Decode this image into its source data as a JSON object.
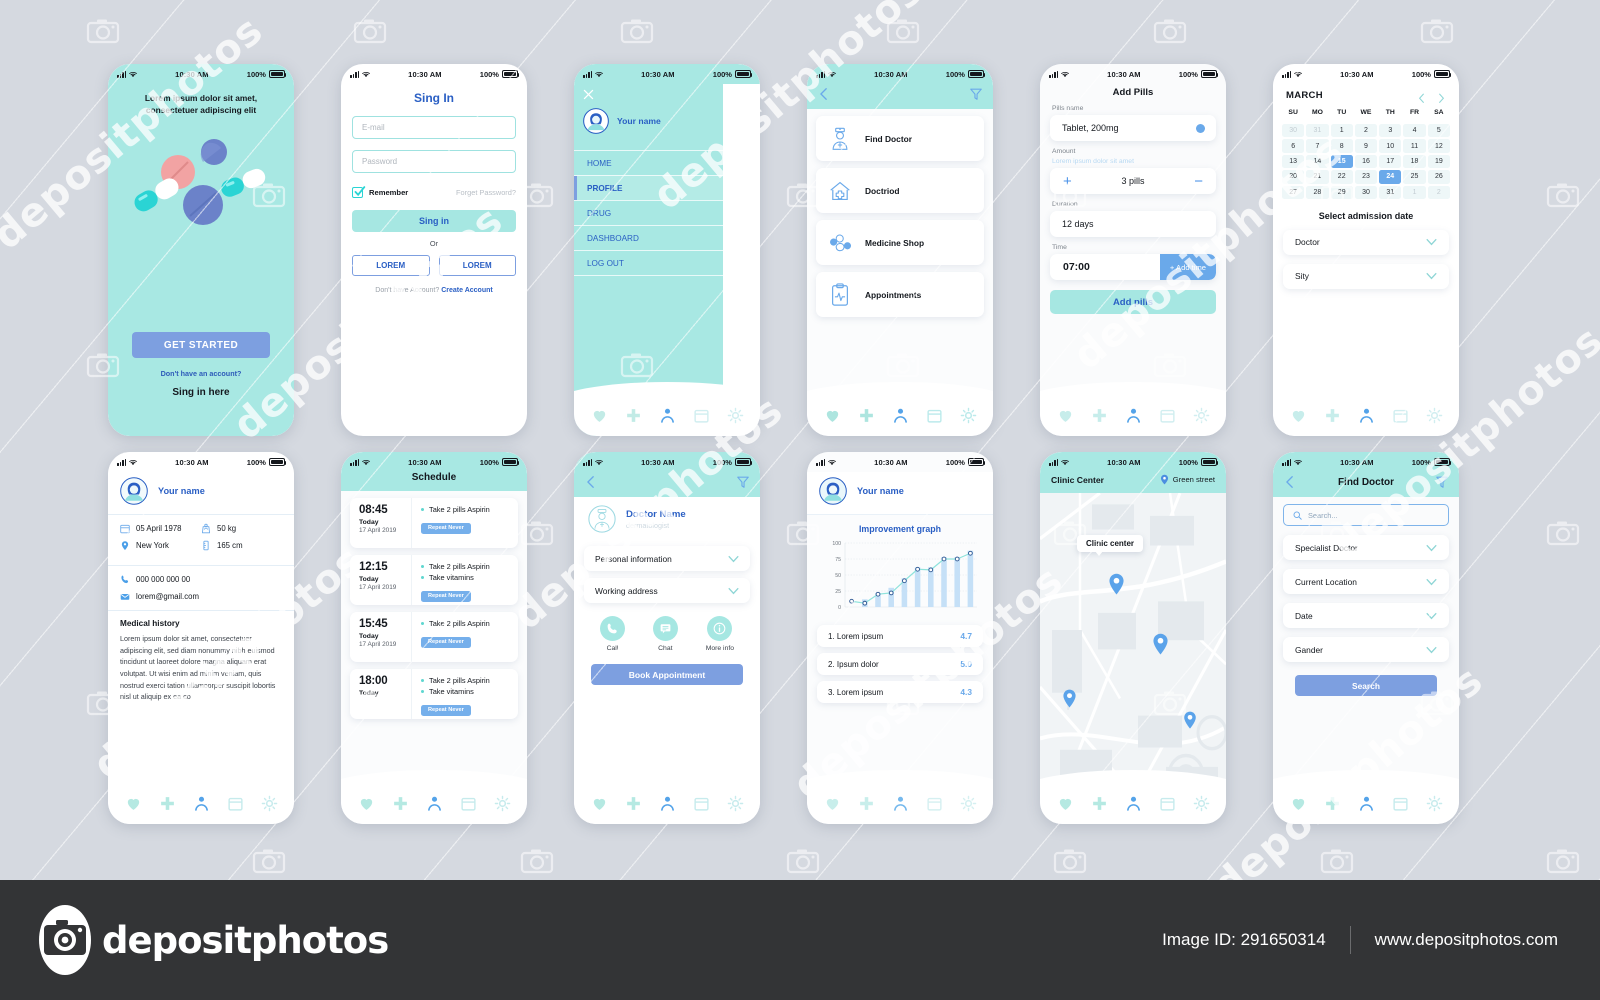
{
  "status_bar": {
    "time": "10:30 AM",
    "battery": "100%"
  },
  "bottom_nav": [
    {
      "icon": "heart-icon"
    },
    {
      "icon": "plus-icon"
    },
    {
      "icon": "person-icon"
    },
    {
      "icon": "calendar-icon"
    },
    {
      "icon": "gear-icon"
    }
  ],
  "screens": {
    "onboarding": {
      "headline": "Lorem ipsum dolor sit amet, consectetuer adipiscing elit",
      "cta": "GET STARTED",
      "no_account": "Don't have an account?",
      "sign_in_here": "Sing in here"
    },
    "signin": {
      "title": "Sing In",
      "email_placeholder": "E-mail",
      "password_placeholder": "Password",
      "remember": "Remember",
      "forget": "Forget Password?",
      "submit": "Sing in",
      "or": "Or",
      "social_left": "LOREM",
      "social_right": "LOREM",
      "footer_prefix": "Don't have Account?",
      "footer_link": "Create Account"
    },
    "drawer": {
      "user_name": "Your name",
      "items": [
        {
          "label": "HOME",
          "active": false
        },
        {
          "label": "PROFILE",
          "active": true
        },
        {
          "label": "DRUG",
          "active": false
        },
        {
          "label": "DASHBOARD",
          "active": false
        },
        {
          "label": "LOG OUT",
          "active": false
        }
      ]
    },
    "services": {
      "items": [
        {
          "label": "Find Doctor",
          "icon": "doctor-icon"
        },
        {
          "label": "Doctriod",
          "icon": "hospital-icon"
        },
        {
          "label": "Medicine Shop",
          "icon": "capsule-icon"
        },
        {
          "label": "Appointments",
          "icon": "clipboard-pulse-icon"
        }
      ]
    },
    "add_pills": {
      "title": "Add Pills",
      "name_label": "Pills name",
      "name_value": "Tablet, 200mg",
      "amount_label": "Amount",
      "amount_hint": "Lorem ipsum dolor sit amet",
      "amount_value": "3 pills",
      "plus": "+",
      "minus": "−",
      "duration_label": "Duration",
      "duration_value": "12 days",
      "time_label": "Time",
      "time_value": "07:00",
      "add_time": "+ Add time",
      "submit": "Add pills"
    },
    "calendar": {
      "month": "MARCH",
      "weekdays": [
        "SU",
        "MO",
        "TU",
        "WE",
        "TH",
        "FR",
        "SA"
      ],
      "days": [
        {
          "n": "30",
          "mute": true
        },
        {
          "n": "31",
          "mute": true
        },
        {
          "n": "1"
        },
        {
          "n": "2"
        },
        {
          "n": "3"
        },
        {
          "n": "4"
        },
        {
          "n": "5"
        },
        {
          "n": "6"
        },
        {
          "n": "7"
        },
        {
          "n": "8"
        },
        {
          "n": "9"
        },
        {
          "n": "10"
        },
        {
          "n": "11"
        },
        {
          "n": "12"
        },
        {
          "n": "13"
        },
        {
          "n": "14"
        },
        {
          "n": "15",
          "selected": true
        },
        {
          "n": "16"
        },
        {
          "n": "17"
        },
        {
          "n": "18"
        },
        {
          "n": "19"
        },
        {
          "n": "20"
        },
        {
          "n": "21"
        },
        {
          "n": "22"
        },
        {
          "n": "23"
        },
        {
          "n": "24",
          "selected": true
        },
        {
          "n": "25"
        },
        {
          "n": "26"
        },
        {
          "n": "27"
        },
        {
          "n": "28"
        },
        {
          "n": "29"
        },
        {
          "n": "30"
        },
        {
          "n": "31"
        },
        {
          "n": "1",
          "mute": true
        },
        {
          "n": "2",
          "mute": true
        }
      ],
      "select_title": "Select admission date",
      "dropdowns": [
        "Doctor",
        "Sity"
      ]
    },
    "profile": {
      "user_name": "Your name",
      "birth_date": "05 April 1978",
      "city": "New York",
      "weight": "50 kg",
      "height": "165 cm",
      "phone": "000 000 000 00",
      "email": "lorem@gmail.com",
      "history_title": "Medical history",
      "history_text": "Lorem ipsum dolor sit amet, consectetuer adipiscing elit, sed diam nonummy nibh euismod tincidunt ut laoreet dolore magna aliquam erat volutpat. Ut wisi enim ad minim veniam, quis nostrud exerci tation ullamcorper suscipit lobortis nisl ut aliquip ex ea co"
    },
    "schedule": {
      "title": "Schedule",
      "items": [
        {
          "time": "08:45",
          "day": "Today",
          "date": "17 April 2019",
          "tasks": [
            "Take 2 pills Aspirin"
          ],
          "repeat": "Repeat Never"
        },
        {
          "time": "12:15",
          "day": "Today",
          "date": "17 April 2019",
          "tasks": [
            "Take 2 pills Aspirin",
            "Take vitamins"
          ],
          "repeat": "Repeat Never"
        },
        {
          "time": "15:45",
          "day": "Today",
          "date": "17 April 2019",
          "tasks": [
            "Take 2 pills Aspirin"
          ],
          "repeat": "Repeat Never"
        },
        {
          "time": "18:00",
          "day": "Today",
          "date": "",
          "tasks": [
            "Take 2 pills Aspirin",
            "Take vitamins"
          ],
          "repeat": "Repeat Never"
        }
      ]
    },
    "doctor": {
      "name": "Doctor Name",
      "specialty": "dermatologist",
      "dropdowns": [
        "Personal information",
        "Working address"
      ],
      "actions": [
        {
          "label": "Call",
          "icon": "phone-icon"
        },
        {
          "label": "Chat",
          "icon": "chat-icon"
        },
        {
          "label": "More info",
          "icon": "info-icon"
        }
      ],
      "book": "Book Appointment"
    },
    "graph": {
      "user_name": "Your name",
      "rows": [
        {
          "label": "1. Lorem ipsum",
          "score": "4.7"
        },
        {
          "label": "2. Ipsum dolor",
          "score": "5.0"
        },
        {
          "label": "3. Lorem ipsum",
          "score": "4.3"
        }
      ]
    },
    "map": {
      "title": "Clinic Center",
      "street": "Green street",
      "tooltip": "Clinic center",
      "pins": 4
    },
    "find_doctor": {
      "title": "Find Doctor",
      "search_placeholder": "Search...",
      "dropdowns": [
        "Specialist Doctor",
        "Current Location",
        "Date",
        "Gander"
      ],
      "submit": "Search"
    }
  },
  "chart_data": {
    "type": "line",
    "title": "Improvement graph",
    "x": [
      1,
      2,
      3,
      4,
      5,
      6,
      7,
      8,
      9,
      10
    ],
    "values": [
      9,
      6,
      20,
      22,
      41,
      59,
      58,
      75,
      75,
      84
    ],
    "bars": [
      0,
      12,
      22,
      30,
      45,
      62,
      62,
      78,
      78,
      88
    ],
    "ylabel": "",
    "xlabel": "",
    "ylim": [
      0,
      100
    ],
    "yticks": [
      0,
      25,
      50,
      75,
      100
    ],
    "grid": true,
    "series": [
      {
        "name": "improvement",
        "values": [
          9,
          6,
          20,
          22,
          41,
          59,
          58,
          75,
          75,
          84
        ]
      }
    ]
  },
  "footer": {
    "brand": "depositphotos",
    "image_id": "Image ID: 291650314",
    "site": "www.depositphotos.com"
  },
  "watermark": {
    "text": "depositphotos"
  },
  "colors": {
    "teal": "#a8e8e3",
    "blue": "#7d9fe0",
    "accent_blue": "#6aa9ea",
    "link_blue": "#2a5fc4",
    "page_bg": "#d5d9e0"
  }
}
